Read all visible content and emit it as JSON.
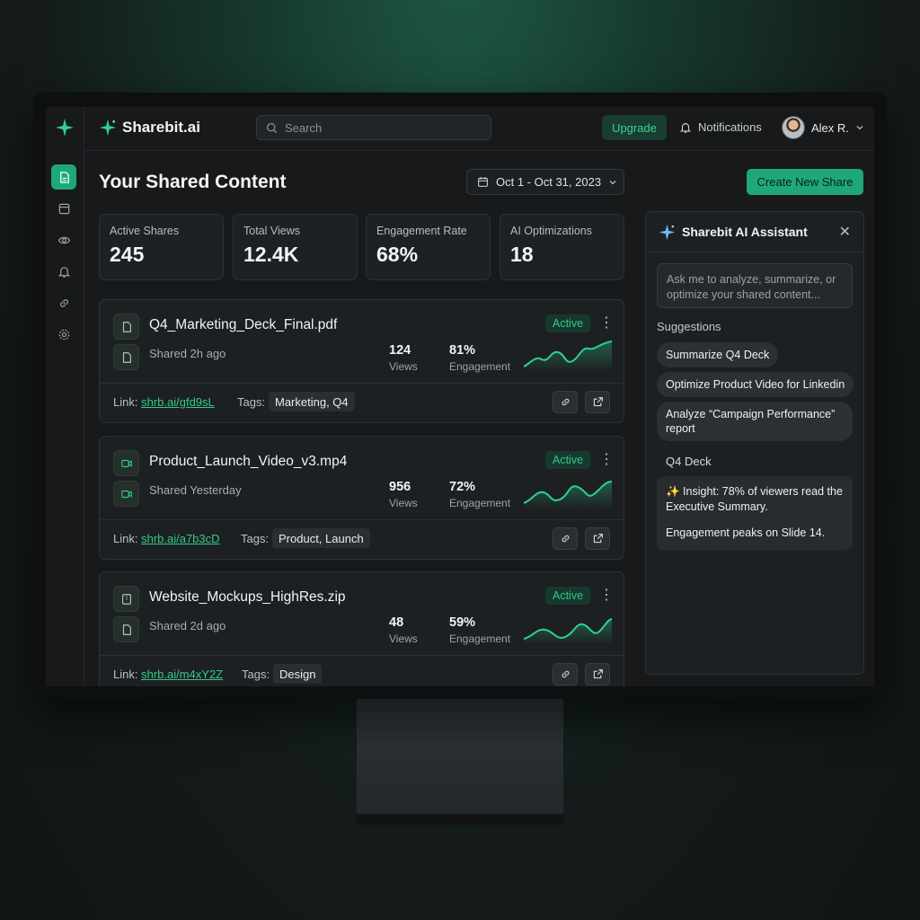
{
  "app": {
    "brand": "Sharebit.ai",
    "search_placeholder": "Search",
    "upgrade_label": "Upgrade",
    "notifications_label": "Notifications",
    "user_name": "Alex R.",
    "accent_color": "#1fa877"
  },
  "sidebar": {
    "items": [
      {
        "icon": "shared-files-icon",
        "active": true
      },
      {
        "icon": "archive-icon",
        "active": false
      },
      {
        "icon": "eye-icon",
        "active": false
      },
      {
        "icon": "bell-icon",
        "active": false
      },
      {
        "icon": "link-icon",
        "active": false
      },
      {
        "icon": "gear-icon",
        "active": false
      }
    ]
  },
  "main": {
    "title": "Your Shared Content",
    "date_range": "Oct 1 - Oct 31, 2023",
    "create_label": "Create New Share"
  },
  "stats": [
    {
      "label": "Active Shares",
      "value": "245"
    },
    {
      "label": "Total Views",
      "value": "12.4K"
    },
    {
      "label": "Engagement Rate",
      "value": "68%"
    },
    {
      "label": "AI Optimizations",
      "value": "18"
    }
  ],
  "shares": [
    {
      "name": "Q4_Marketing_Deck_Final.pdf",
      "shared": "Shared 2h ago",
      "status": "Active",
      "views": "124",
      "views_label": "Views",
      "engagement": "81%",
      "engagement_label": "Engagement",
      "link_label": "Link:",
      "link": "shrb.ai/gfd9sL",
      "tags_label": "Tags:",
      "tags": "Marketing, Q4",
      "type_icon": "document-icon"
    },
    {
      "name": "Product_Launch_Video_v3.mp4",
      "shared": "Shared Yesterday",
      "status": "Active",
      "views": "956",
      "views_label": "Views",
      "engagement": "72%",
      "engagement_label": "Engagement",
      "link_label": "Link:",
      "link": "shrb.ai/a7b3cD",
      "tags_label": "Tags:",
      "tags": "Product, Launch",
      "type_icon": "video-icon"
    },
    {
      "name": "Website_Mockups_HighRes.zip",
      "shared": "Shared 2d ago",
      "status": "Active",
      "views": "48",
      "views_label": "Views",
      "engagement": "59%",
      "engagement_label": "Engagement",
      "link_label": "Link:",
      "link": "shrb.ai/m4xY2Z",
      "tags_label": "Tags:",
      "tags": "Design",
      "type_icon": "archive-file-icon"
    }
  ],
  "assistant": {
    "title": "Sharebit AI Assistant",
    "input_placeholder": "Ask me to analyze, summarize, or optimize your shared content...",
    "suggestions_label": "Suggestions",
    "suggestions": [
      "Summarize Q4 Deck",
      "Optimize Product Video for Linkedin",
      "Analyze “Campaign Performance” report"
    ],
    "context_label": "Q4 Deck",
    "insight_line1": "✨ Insight: 78% of viewers read the Executive Summary.",
    "insight_line2": "Engagement peaks on Slide 14."
  }
}
